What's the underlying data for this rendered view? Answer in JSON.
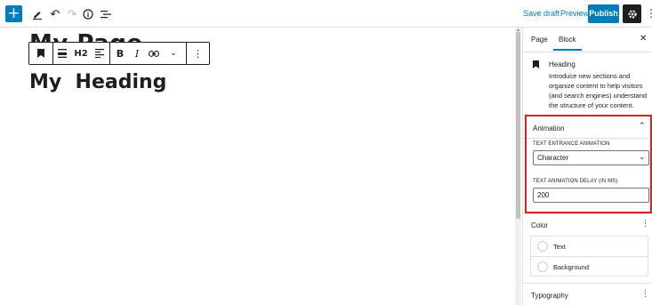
{
  "topbar": {
    "add_icon": "plus-icon",
    "tools_icon": "pencil-icon",
    "undo_icon": "undo-icon",
    "redo_icon": "redo-icon",
    "details_icon": "info-icon",
    "outline_icon": "list-view-icon",
    "save_draft": "Save draft",
    "preview": "Preview",
    "publish": "Publish",
    "settings_icon": "gear-icon",
    "more_icon": "more-vertical-icon"
  },
  "editor": {
    "page_title": "My Page",
    "heading": "My  Heading",
    "toolbar": {
      "block_type_icon": "bookmark-icon",
      "align_icon": "align-icon",
      "heading_level": "H2",
      "text_align_icon": "text-align-icon",
      "bold": "B",
      "italic": "I",
      "link_icon": "link-icon",
      "more_formatting_icon": "chevron-down-icon",
      "options_icon": "more-vertical-icon"
    }
  },
  "sidebar": {
    "tabs": [
      "Page",
      "Block"
    ],
    "active_tab": "Block",
    "close_icon": "close-icon",
    "block": {
      "icon": "bookmark-icon",
      "name": "Heading",
      "description": "Introduce new sections and organize content to help visitors (and search engines) understand the structure of your content."
    },
    "animation": {
      "title": "Animation",
      "entrance_label": "TEXT ENTRANCE ANIMATION",
      "entrance_value": "Character",
      "delay_label": "TEXT ANIMATION DELAY (IN MS)",
      "delay_value": "200",
      "highlight_color": "#e01e1e"
    },
    "color": {
      "title": "Color",
      "items": [
        "Text",
        "Background"
      ]
    },
    "typography": {
      "title": "Typography"
    }
  },
  "colors": {
    "accent": "#007cba",
    "dark": "#1e1e1e"
  }
}
